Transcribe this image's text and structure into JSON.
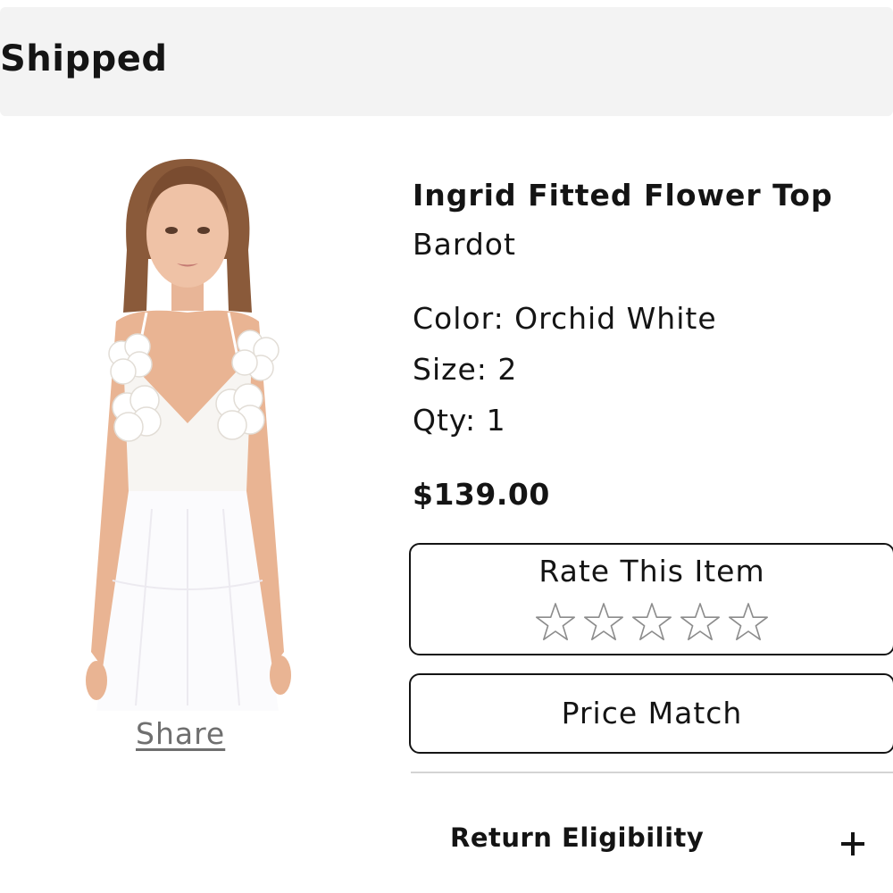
{
  "order": {
    "status": "Shipped"
  },
  "product": {
    "name": "Ingrid Fitted Flower Top",
    "brand": "Bardot",
    "color_text": "Color: Orchid White",
    "size_text": "Size: 2",
    "qty_text": "Qty: 1",
    "price": "$139.00",
    "image_icon": "product-photo-model-white-flower-top",
    "share_label": "Share"
  },
  "rating": {
    "title": "Rate This Item",
    "max_stars": 5,
    "current_rating": 0,
    "star_icon": "star-outline-icon"
  },
  "actions": {
    "price_match_label": "Price Match"
  },
  "accordion": {
    "return_eligibility_label": "Return Eligibility",
    "expand_icon": "plus-icon",
    "expanded": false
  },
  "colors": {
    "status_bar_bg": "#f3f3f3",
    "text": "#141414",
    "link": "#6f6f6f",
    "divider": "#d4d4d4",
    "star_outline": "#8c8c8c"
  }
}
